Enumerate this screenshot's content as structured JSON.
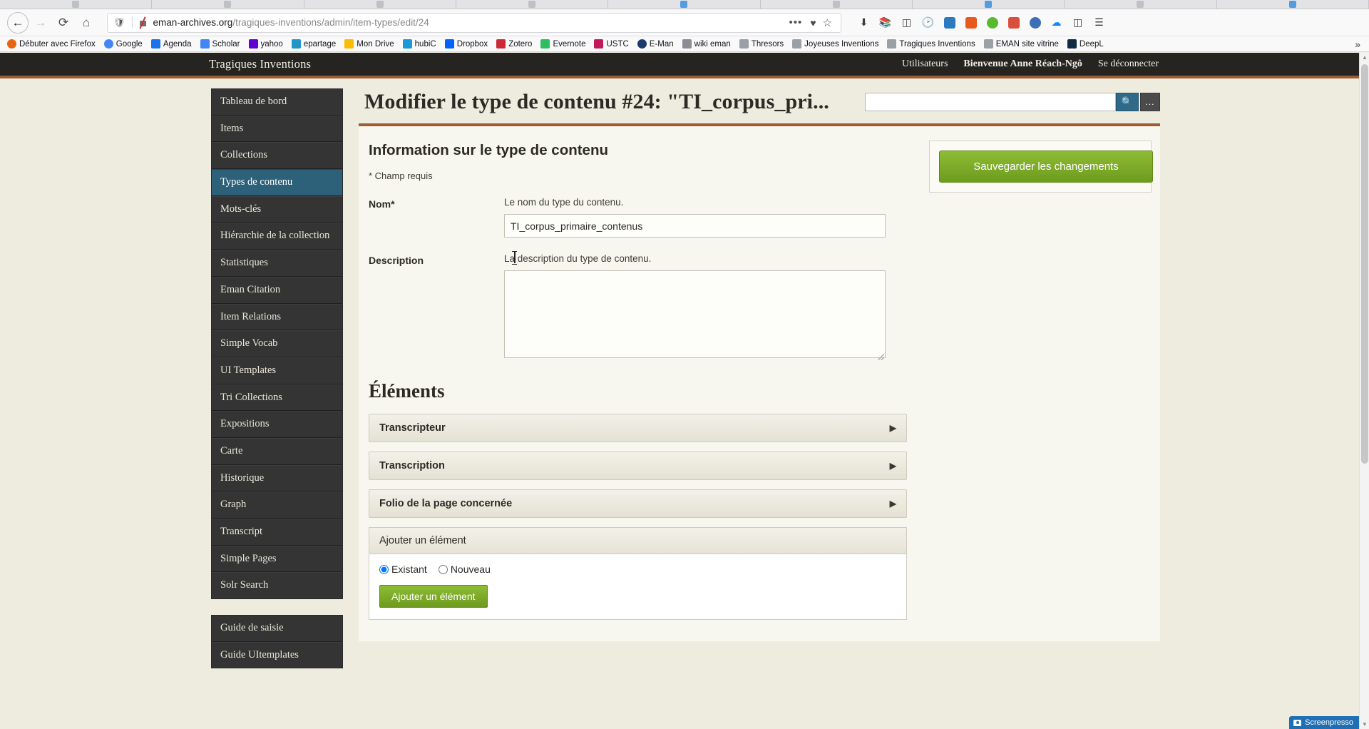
{
  "browser": {
    "url_host": "eman-archives.org",
    "url_path": "/tragiques-inventions/admin/item-types/edit/24",
    "back_icon": "←",
    "forward_icon": "→",
    "reload_icon": "⟳",
    "home_icon": "⌂",
    "shield_icon": "shield-icon",
    "menu_dots": "•••",
    "pocket_icon": "♥",
    "star_icon": "☆",
    "toolbar_icons": [
      "download-icon",
      "library-icon",
      "sidebar-icon",
      "clock-icon",
      "screenshot-icon",
      "translate-icon",
      "plugin-icon",
      "camera-icon",
      "account-icon",
      "sync-icon",
      "reader-icon",
      "hamburger-menu-icon"
    ],
    "bookmarks": [
      {
        "label": "Débuter avec Firefox",
        "icon": "firefox-icon",
        "color": "#e8650d"
      },
      {
        "label": "Google",
        "icon": "google-icon",
        "color": "#4285f4"
      },
      {
        "label": "Agenda",
        "icon": "calendar-icon",
        "color": "#1a73e8"
      },
      {
        "label": "Scholar",
        "icon": "scholar-icon",
        "color": "#4285f4"
      },
      {
        "label": "yahoo",
        "icon": "mail-icon",
        "color": "#6001d2"
      },
      {
        "label": "epartage",
        "icon": "epartage-icon",
        "color": "#2196c9"
      },
      {
        "label": "Mon Drive",
        "icon": "drive-icon",
        "color": "#fbbc04"
      },
      {
        "label": "hubiC",
        "icon": "hubic-icon",
        "color": "#1a9bd7"
      },
      {
        "label": "Dropbox",
        "icon": "dropbox-icon",
        "color": "#0061ff"
      },
      {
        "label": "Zotero",
        "icon": "zotero-icon",
        "color": "#cc2936"
      },
      {
        "label": "Evernote",
        "icon": "evernote-icon",
        "color": "#2dbe60"
      },
      {
        "label": "USTC",
        "icon": "ustc-icon",
        "color": "#c2185b"
      },
      {
        "label": "E-Man",
        "icon": "eman-icon",
        "color": "#1a3a6b"
      },
      {
        "label": "wiki eman",
        "icon": "wiki-icon",
        "color": "#8a8d93"
      },
      {
        "label": "Thresors",
        "icon": "bookmark-icon",
        "color": "#9aa0a6"
      },
      {
        "label": "Joyeuses Inventions",
        "icon": "bookmark-icon",
        "color": "#9aa0a6"
      },
      {
        "label": "Tragiques Inventions",
        "icon": "bookmark-icon",
        "color": "#9aa0a6"
      },
      {
        "label": "EMAN site vitrine",
        "icon": "bookmark-icon",
        "color": "#9aa0a6"
      },
      {
        "label": "DeepL",
        "icon": "deepl-icon",
        "color": "#0f2b46"
      }
    ],
    "bookmarks_overflow": "»"
  },
  "admin": {
    "site_title": "Tragiques Inventions",
    "users_link": "Utilisateurs",
    "welcome": "Bienvenue Anne Réach-Ngô",
    "logout": "Se déconnecter"
  },
  "sidebar": {
    "primary": [
      {
        "label": "Tableau de bord",
        "active": false
      },
      {
        "label": "Items",
        "active": false
      },
      {
        "label": "Collections",
        "active": false
      },
      {
        "label": "Types de contenu",
        "active": true
      },
      {
        "label": "Mots-clés",
        "active": false
      },
      {
        "label": "Hiérarchie de la collection",
        "active": false
      },
      {
        "label": "Statistiques",
        "active": false
      },
      {
        "label": "Eman Citation",
        "active": false
      },
      {
        "label": "Item Relations",
        "active": false
      },
      {
        "label": "Simple Vocab",
        "active": false
      },
      {
        "label": "UI Templates",
        "active": false
      },
      {
        "label": "Tri Collections",
        "active": false
      },
      {
        "label": "Expositions",
        "active": false
      },
      {
        "label": "Carte",
        "active": false
      },
      {
        "label": "Historique",
        "active": false
      },
      {
        "label": "Graph",
        "active": false
      },
      {
        "label": "Transcript",
        "active": false
      },
      {
        "label": "Simple Pages",
        "active": false
      },
      {
        "label": "Solr Search",
        "active": false
      }
    ],
    "secondary": [
      {
        "label": "Guide de saisie"
      },
      {
        "label": "Guide UItemplates"
      }
    ]
  },
  "main": {
    "page_title": "Modifier le type de contenu #24: \"TI_corpus_pri...",
    "search": {
      "value": "",
      "placeholder": "",
      "button_icon": "search-icon",
      "advanced_label": "..."
    },
    "section_title": "Information sur le type de contenu",
    "required_note": "* Champ requis",
    "fields": [
      {
        "label": "Nom*",
        "description": "Le nom du type du contenu.",
        "value": "TI_corpus_primaire_contenus",
        "type": "text"
      },
      {
        "label": "Description",
        "description": "La description du type de contenu.",
        "value": "",
        "type": "textarea"
      }
    ],
    "elements_title": "Éléments",
    "elements": [
      {
        "label": "Transcripteur",
        "arrow": "▶"
      },
      {
        "label": "Transcription",
        "arrow": "▶"
      },
      {
        "label": "Folio de la page concernée",
        "arrow": "▶"
      }
    ],
    "add_element": {
      "header": "Ajouter un élément",
      "options": [
        {
          "label": "Existant",
          "checked": true
        },
        {
          "label": "Nouveau",
          "checked": false
        }
      ],
      "button": "Ajouter un élément"
    },
    "save_button": "Sauvegarder les changements"
  },
  "statusbar": {
    "screenpresso": "Screenpresso"
  },
  "colors": {
    "accent_orange": "#9c5c32",
    "active_blue": "#2c6179",
    "green_button": "#6f9b1e",
    "header_dark": "#262420",
    "page_bg": "#edecdf"
  }
}
